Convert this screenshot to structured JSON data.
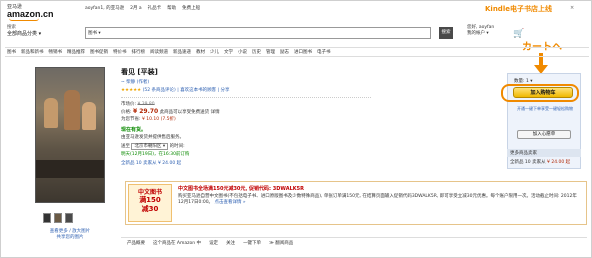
{
  "header": {
    "logo_cn": "亚马逊",
    "logo_text": "amazon.cn",
    "top_links": [
      "aoyfan1, 的亚马逊",
      "2月 a",
      "礼品卡",
      "帮助",
      "免费上船"
    ],
    "kindle_promo": "Kindle电子书店上线",
    "close": "×"
  },
  "search": {
    "dept_label": "搜索",
    "dept_value": "全部商品分类 ▾",
    "scope": "图书 ▾",
    "go_label": "搜索",
    "account_line1": "您好, aoyfan",
    "account_line2": "我的帐户 ▾",
    "cart_icon": "🛒",
    "cart_label": "",
    "callout": "カートヘ"
  },
  "nav": {
    "items": [
      "图书",
      "新品和新书",
      "畅销书",
      "精品推荐",
      "图书促销",
      "特价书",
      "排行榜",
      "阅读频道",
      "新品速递",
      "教材",
      "少儿",
      "文学",
      "小说",
      "历史",
      "管理",
      "励志",
      "进口图书",
      "电子书"
    ]
  },
  "product": {
    "title": "看见 [平装]",
    "author": "~ 柴静 (作者)",
    "stars": "★★★★★",
    "rating_text": "(52 条商品评论) | 喜欢这本书的顾客 | 分享",
    "list_price_label": "市场价:",
    "list_price": "¥ 39.80",
    "price_label": "价格:",
    "price": "¥ 29.70",
    "price_note": "此商品可以享受免费送货 详情",
    "save_label": "为您节省:",
    "save": "¥ 10.10 (7.5折)",
    "stock": "现在有货。",
    "ship_note": "由亚马逊发货并提供售后服务。",
    "deliver_label": "送至",
    "deliver_select": "北京市朝阳区 ▾",
    "deliver_suffix": "的时间:",
    "deliver_time": "明天(12月19日)，在16:30前订购",
    "others": "全新品 10 卖家从 ¥ 24.00 起"
  },
  "gallery": {
    "view_large": "查看更多 / 放大图片",
    "share": "共享您的图片"
  },
  "buybox": {
    "qty": "数量: 1 ▾",
    "add_to_cart": "加入购物车",
    "one_click": "开通一键下单享受一键轻松购物",
    "wishlist": "加入心愿单",
    "sellers_header": "更多商品卖家",
    "sellers_row": "全新品 10 卖家从",
    "sellers_price": "¥ 24.00 起"
  },
  "promo": {
    "badge_line1": "中文图书",
    "badge_line2": "满150",
    "badge_line3": "减30",
    "headline": "中文图书全场满150元减30元, 促销代码: 3DWALK5R",
    "body": "购买亚马逊自营中文图书(不包括电子书、进口原版图书及少数特殊商品), 单张订单满150元, 在结算页面输入促销代码3DWALK5R, 即可享受立减30元优惠。每个账户限用一次。活动截止时间: 2012年12月17日0:00。",
    "link": "点击查看详情 »"
  },
  "bottom": {
    "items": [
      "产品概要",
      "这个商品在 Amazon 中",
      "设定",
      "关注",
      "一键下单",
      "≫ 翻阅商品"
    ]
  }
}
